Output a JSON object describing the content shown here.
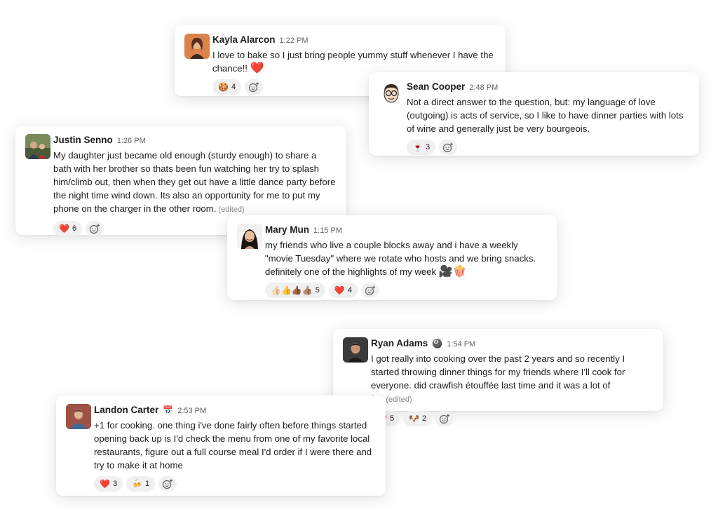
{
  "messages": [
    {
      "name": "Kayla Alarcon",
      "time": "1:22 PM",
      "text": "I love to bake so I just bring people yummy stuff whenever I have the chance!!",
      "trail_emoji": "❤️",
      "reactions": [
        {
          "emoji": "🍪",
          "count": "4"
        }
      ]
    },
    {
      "name": "Sean Cooper",
      "time": "2:48 PM",
      "text": "Not a direct answer to the question, but:  my language of love (outgoing) is acts of service, so I like to have dinner parties with lots of wine and generally just be very bourgeois.",
      "reactions": [
        {
          "emoji": "🍷",
          "count": "3"
        }
      ]
    },
    {
      "name": "Justin Senno",
      "time": "1:26 PM",
      "text": "My daughter just became old enough (sturdy enough) to share a bath with her brother so thats been fun watching her try to splash him/climb out, then when they get out have a little dance party before the night time wind down. Its also an opportunity for me to put my phone on the charger in the other room.",
      "edited": "(edited)",
      "reactions": [
        {
          "emoji": "❤️",
          "count": "6"
        }
      ]
    },
    {
      "name": "Mary Mun",
      "time": "1:15 PM",
      "text": "my friends who live a couple blocks away and i have a weekly \"movie Tuesday\" where we rotate who hosts and we bring snacks. definitely one of the highlights of my week",
      "trail_emoji": "🎥🍿",
      "reactions": [
        {
          "emoji": "👍🏻👍👍🏾👍🏽",
          "count": "5"
        },
        {
          "emoji": "❤️",
          "count": "4"
        }
      ]
    },
    {
      "name": "Ryan Adams",
      "badge": "🎱",
      "time": "1:54 PM",
      "text": "I got really into cooking over the past 2 years and so recently I started throwing dinner things for my friends where I'll cook for everyone. did crawfish étouffée last time and it was a lot of fun",
      "edited": "(edited)",
      "reactions": [
        {
          "emoji": "❤️",
          "count": "5"
        },
        {
          "emoji": "🐶",
          "count": "2"
        }
      ]
    },
    {
      "name": "Landon Carter",
      "badge": "📅",
      "time": "2:53 PM",
      "text": "+1 for cooking. one thing i've done fairly often before things started opening back up is I'd check the menu from one of my favorite local restaurants, figure out a full course meal I'd order if I were there and try to make it at home",
      "reactions": [
        {
          "emoji": "❤️",
          "count": "3"
        },
        {
          "emoji": "🍻",
          "count": "1"
        }
      ]
    }
  ]
}
